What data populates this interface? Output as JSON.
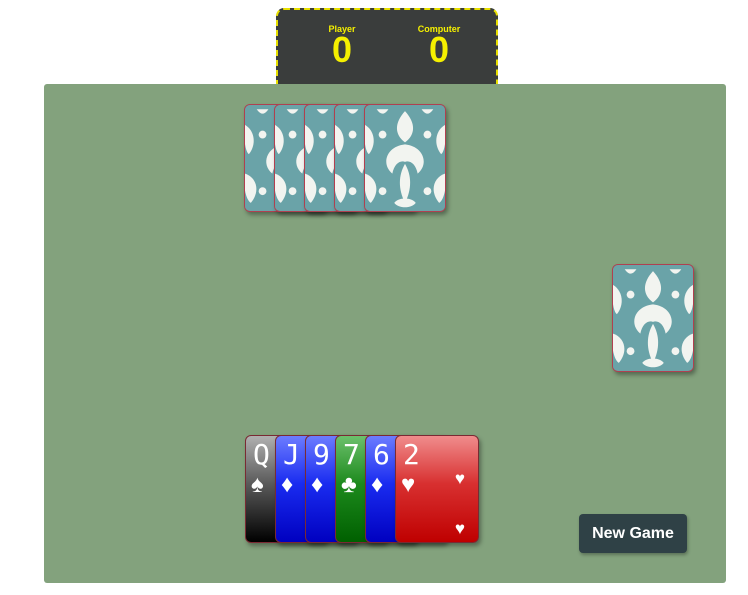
{
  "scoreboard": {
    "player_label": "Player",
    "player_score": "0",
    "computer_label": "Computer",
    "computer_score": "0",
    "label_color": "#f5f000"
  },
  "computer_hand": {
    "card_count": 5,
    "card_back": "damask-pattern"
  },
  "deck": {
    "card_back": "damask-pattern"
  },
  "player_hand": {
    "cards": [
      {
        "rank": "Q",
        "suit": "spades",
        "symbol": "♠"
      },
      {
        "rank": "J",
        "suit": "diamonds",
        "symbol": "♦"
      },
      {
        "rank": "9",
        "suit": "diamonds",
        "symbol": "♦"
      },
      {
        "rank": "7",
        "suit": "clubs",
        "symbol": "♣"
      },
      {
        "rank": "6",
        "suit": "diamonds",
        "symbol": "♦"
      },
      {
        "rank": "2",
        "suit": "hearts",
        "symbol": "♥"
      }
    ]
  },
  "controls": {
    "new_game_label": "New Game"
  },
  "colors": {
    "table": "#83a27d",
    "card_back": "#6aa3a8",
    "button": "#2f4146"
  }
}
